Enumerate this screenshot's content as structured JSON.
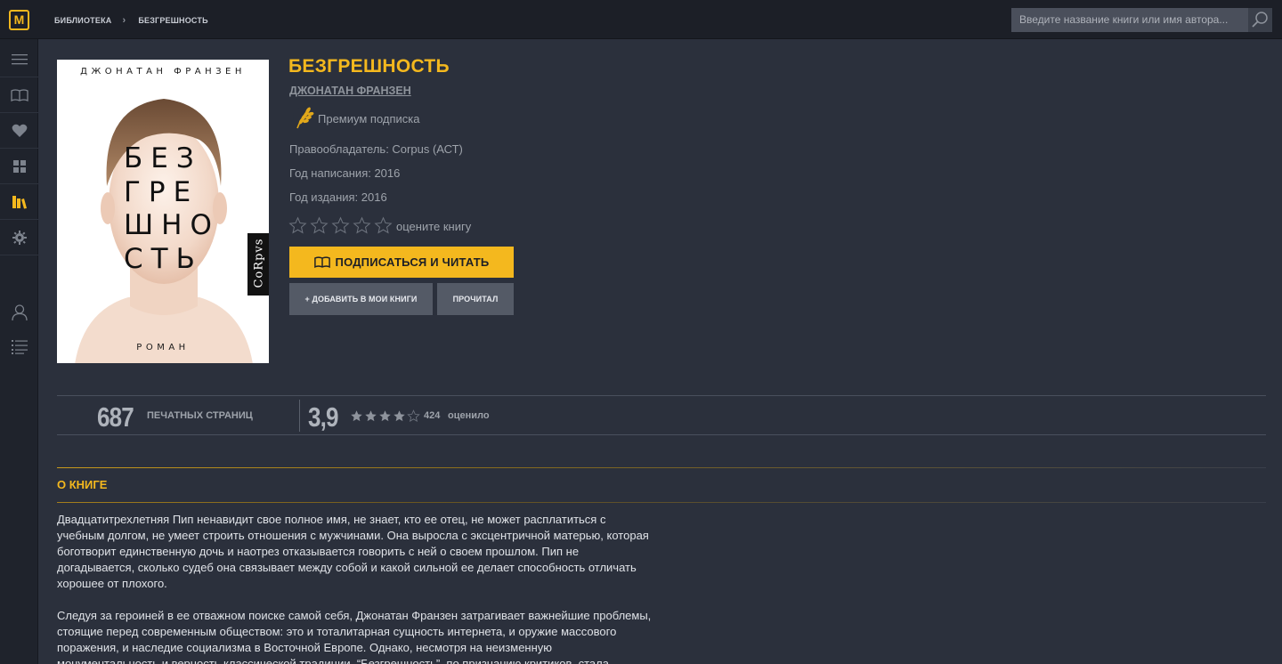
{
  "app": {
    "logo_letter": "M"
  },
  "breadcrumb": {
    "items": [
      "БИБЛИОТЕКА",
      "БЕЗГРЕШНОСТЬ"
    ],
    "separator": "›"
  },
  "search": {
    "placeholder": "Введите название книги или имя автора..."
  },
  "sidebar": {
    "items": [
      {
        "icon": "menu-icon"
      },
      {
        "icon": "open-book-icon"
      },
      {
        "icon": "heart-icon"
      },
      {
        "icon": "grid-icon"
      },
      {
        "icon": "bookshelf-icon",
        "active": true
      },
      {
        "icon": "gear-icon"
      },
      {
        "icon": "user-icon"
      },
      {
        "icon": "list-icon"
      }
    ]
  },
  "cover": {
    "author": "ДЖОНАТАН ФРАНЗЕН",
    "title_lines": "БЕЗ\nГРЕ\nШНО\nСТЬ",
    "subtitle": "РОМАН",
    "publisher": "CoRpvs"
  },
  "book": {
    "title": "БЕЗГРЕШНОСТЬ",
    "author": "ДЖОНАТАН ФРАНЗЕН",
    "subscription": "Премиум подписка",
    "rightsholder": "Правообладатель: Corpus (АСТ)",
    "year_written": "Год написания: 2016",
    "year_published": "Год издания: 2016",
    "rate_prompt": "оцените книгу",
    "user_rating": 0,
    "max_rating": 5
  },
  "actions": {
    "subscribe_read": "ПОДПИСАТЬСЯ И ЧИТАТЬ",
    "add_to_my_books": "+ ДОБАВИТЬ В МОИ КНИГИ",
    "read": "ПРОЧИТАЛ"
  },
  "stats": {
    "pages": "687",
    "pages_label": "ПЕЧАТНЫХ СТРАНИЦ",
    "rating": "3,9",
    "rating_value": 3.9,
    "votes": "424",
    "votes_label": "оценило"
  },
  "about": {
    "title": "О КНИГЕ",
    "paragraphs": [
      "Двадцатитрехлетняя Пип ненавидит свое полное имя, не знает, кто ее отец, не может расплатиться с учебным долгом, не умеет строить отношения с мужчинами. Она выросла с эксцентричной матерью, которая боготворит единственную дочь и наотрез отказывается говорить с ней о своем прошлом. Пип не догадывается, сколько судеб она связывает между собой и какой сильной ее делает способность отличать хорошее от плохого.",
      "Следуя за героиней в ее отважном поиске самой себя, Джонатан Франзен затрагивает важнейшие проблемы, стоящие перед современным обществом: это и тоталитарная сущность интернета, и оружие массового поражения, и наследие социализма в Восточной Европе. Однако, несмотря на неизменную монументальность и верность классической традиции, “Безгрешность”, по признанию критиков, стала"
    ]
  },
  "colors": {
    "accent": "#f4b81e",
    "background": "#2b303c",
    "topbar": "#1c1f27",
    "sidebar": "#1f232c"
  }
}
